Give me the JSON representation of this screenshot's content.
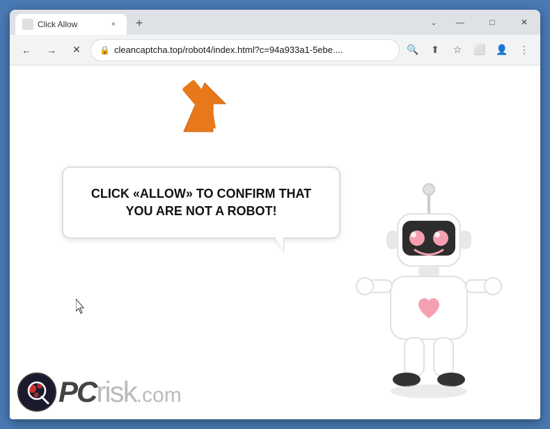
{
  "browser": {
    "tab": {
      "title": "Click Allow",
      "close_label": "×"
    },
    "new_tab_label": "+",
    "window_controls": {
      "minimize": "—",
      "maximize": "□",
      "close": "✕"
    },
    "toolbar": {
      "back_icon": "←",
      "forward_icon": "→",
      "reload_icon": "✕",
      "url": "cleancaptcha.top/robot4/index.html?c=94a933a1-5ebe....",
      "lock_icon": "🔒",
      "search_icon": "🔍",
      "share_icon": "⬆",
      "bookmark_icon": "☆",
      "extension_icon": "⬜",
      "account_icon": "👤",
      "menu_icon": "⋮"
    }
  },
  "page": {
    "bubble_text": "CLICK «ALLOW» TO CONFIRM THAT YOU ARE NOT A ROBOT!",
    "logo_text": "PC",
    "logo_risk": "risk",
    "logo_dot_com": ".com"
  }
}
